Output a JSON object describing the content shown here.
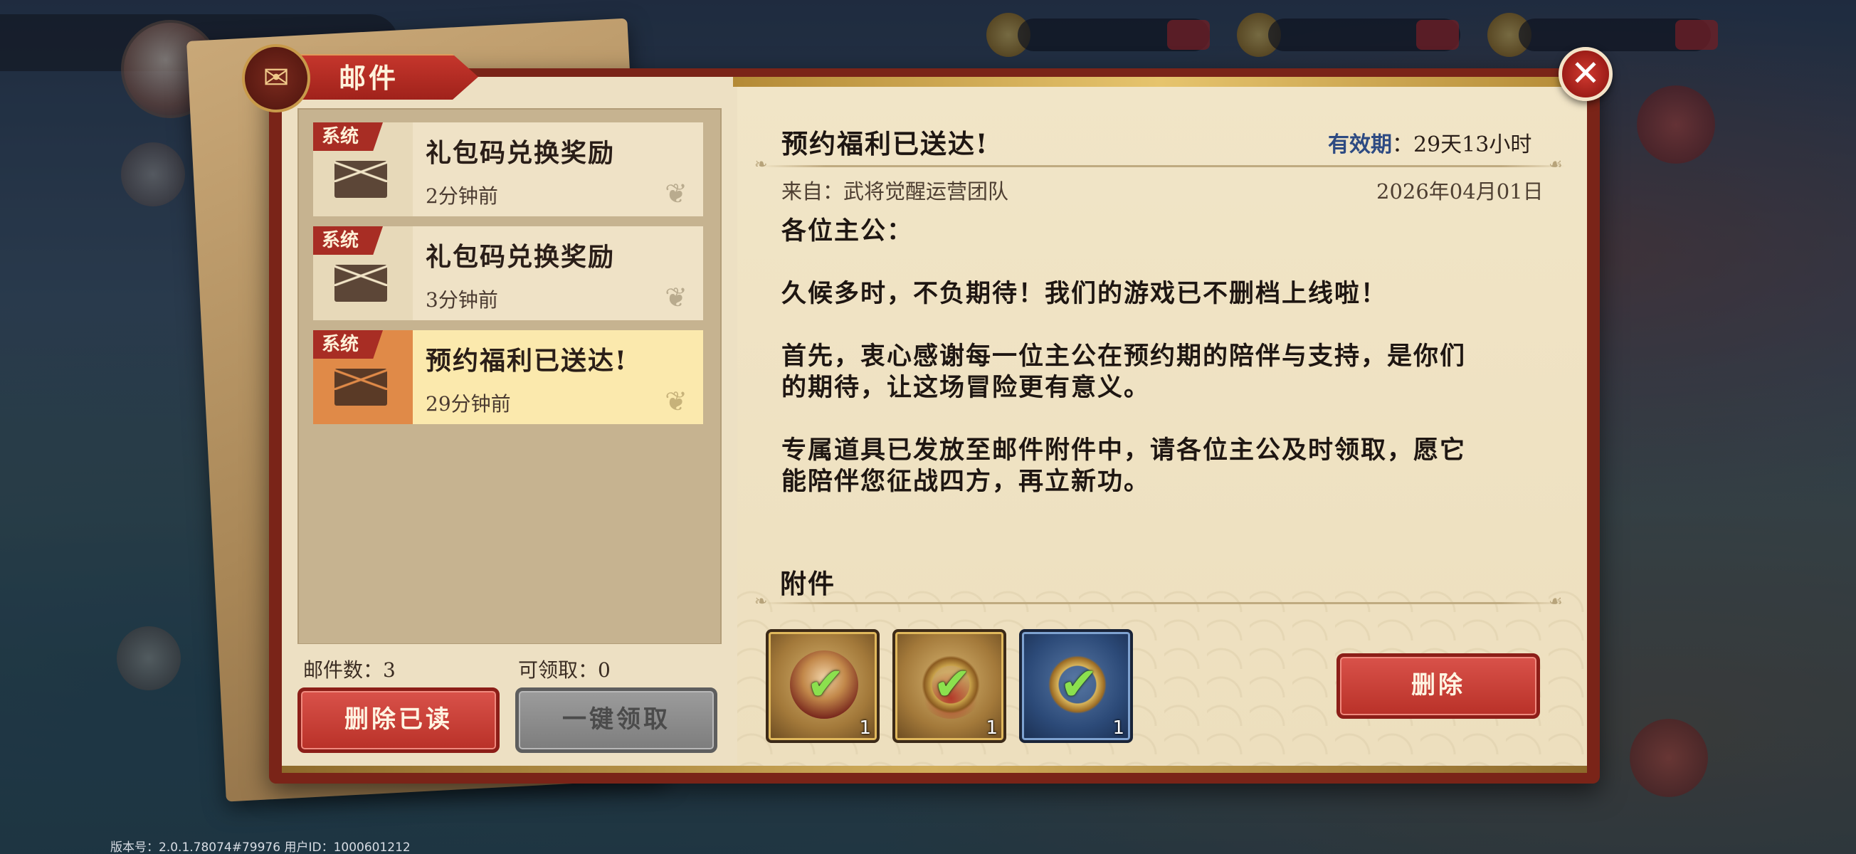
{
  "dialog": {
    "title": "邮件",
    "close_symbol": "✕"
  },
  "mail_list": [
    {
      "tag": "系统",
      "title": "礼包码兑换奖励",
      "time": "2分钟前",
      "selected": false
    },
    {
      "tag": "系统",
      "title": "礼包码兑换奖励",
      "time": "3分钟前",
      "selected": false
    },
    {
      "tag": "系统",
      "title": "预约福利已送达!",
      "time": "29分钟前",
      "selected": true
    }
  ],
  "stats": {
    "mail_count": "邮件数：3",
    "claimable": "可领取：0"
  },
  "buttons": {
    "delete_read": "删除已读",
    "claim_all": "一键领取",
    "delete": "删除"
  },
  "message": {
    "subject": "预约福利已送达!",
    "validity_label": "有效期",
    "validity_value": "：29天13小时",
    "sender": "来自：武将觉醒运营团队",
    "date": "2026年04月01日",
    "body_lines": [
      "各位主公：",
      "久候多时，不负期待！我们的游戏已不删档上线啦！",
      "首先，衷心感谢每一位主公在预约期的陪伴与支持，是你们",
      "的期待，让这场冒险更有意义。",
      "专属道具已发放至邮件附件中，请各位主公及时领取，愿它",
      "能陪伴您征战四方，再立新功。"
    ],
    "attachment_heading": "附件"
  },
  "attachments": [
    {
      "icon": "hero-portrait-icon",
      "claimed": true,
      "count": "1",
      "rarity": "gold"
    },
    {
      "icon": "bangle-icon",
      "claimed": true,
      "count": "1",
      "rarity": "gold"
    },
    {
      "icon": "ring-icon",
      "claimed": true,
      "count": "1",
      "rarity": "blue"
    }
  ],
  "footer": {
    "version": "版本号：2.0.1.78074#79976 用户ID：1000601212"
  },
  "colors": {
    "frame": "#7a2418",
    "accent_red": "#b93128",
    "selected_item": "#fbe9ad",
    "validity_label": "#2d4a82",
    "check": "#8be04e"
  }
}
